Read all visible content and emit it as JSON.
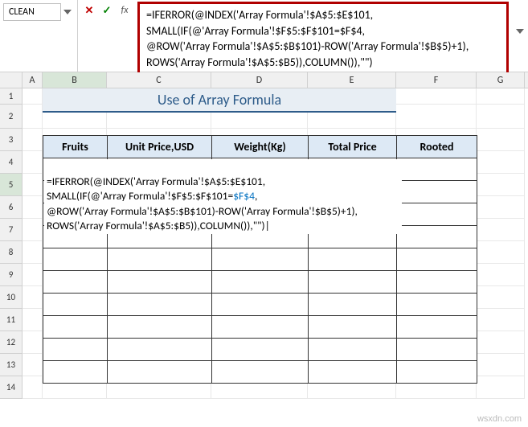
{
  "name_box": {
    "value": "CLEAN"
  },
  "formula_bar": {
    "line1": "=IFERROR(@INDEX('Array Formula'!$A$5:$E$101,",
    "line2": "SMALL(IF(@'Array Formula'!$F$5:$F$101=$F$4,",
    "line3": "@ROW('Array Formula'!$A$5:$B$101)-ROW('Array Formula'!$B$5)+1),",
    "line4": "ROWS('Array Formula'!$A$5:$B5)),COLUMN()),\"\")"
  },
  "columns": [
    "A",
    "B",
    "C",
    "D",
    "E",
    "F",
    "G"
  ],
  "rows": [
    "1",
    "2",
    "3",
    "4",
    "5",
    "6",
    "7",
    "8",
    "9",
    "10",
    "11",
    "12",
    "13",
    "14"
  ],
  "title": "Use of Array Formula",
  "headers": {
    "fruits": "Fruits",
    "unit_price": "Unit Price,USD",
    "weight": "Weight(Kg)",
    "total_price": "Total Price",
    "rooted": "Rooted"
  },
  "editing": {
    "line1": "=IFERROR(@INDEX('Array Formula'!$A$5:$E$101,",
    "line2_a": "SMALL(IF(@'Array Formula'!$F$5:$F$101=",
    "line2_ref": "$F$4",
    "line2_b": ",",
    "line3": "@ROW('Array Formula'!$A$5:$B$101)-ROW('Array Formula'!$B$5)+1),",
    "line4": "ROWS('Array Formula'!$A$5:$B5)),COLUMN()),\"\")|"
  },
  "watermark": "wsxdn.com"
}
